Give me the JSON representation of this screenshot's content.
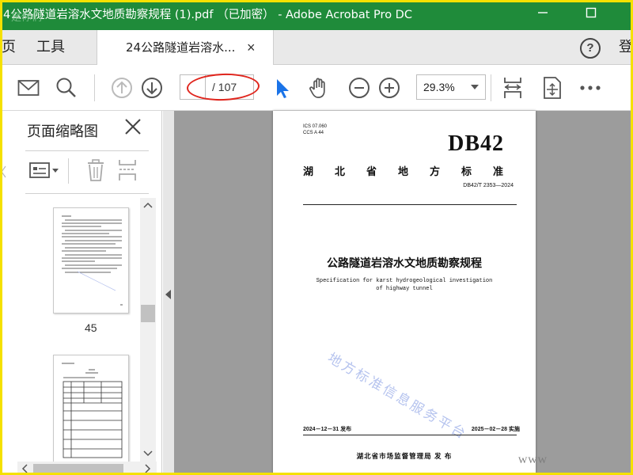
{
  "window": {
    "title": "4公路隧道岩溶水文地质勘察规程 (1).pdf （已加密） - Adobe Acrobat Pro DC",
    "ghost_text": "是你们"
  },
  "menu": {
    "home_label": "页",
    "tools_label": "工具",
    "doc_tab_label": "24公路隧道岩溶水...",
    "doc_tab_close": "×",
    "help_label": "?",
    "login_label": "登"
  },
  "toolbar": {
    "current_page": "",
    "total_pages": "/ 107",
    "zoom": "29.3%"
  },
  "thumbnails_panel": {
    "title": "页面缩略图",
    "thumbs": [
      {
        "page_number": "45"
      }
    ]
  },
  "document": {
    "ics_line": "ICS 07.060",
    "ccs_line": "CCS A 44",
    "logo": "DB42",
    "province_heading": "湖北省地方标准",
    "standard_number": "DB42/T 2353—2024",
    "title_cn": "公路隧道岩溶水文地质勘察规程",
    "title_en": "Specification for karst hydrogeological investigation of highway tunnel",
    "watermark": "地方标准信息服务平台",
    "publish_date": "2024－12－31 发布",
    "implement_date": "2025－02－28 实施",
    "issuer": "湖北省市场监督管理局    发 布"
  },
  "overlay": {
    "www": "WWW"
  },
  "colors": {
    "titlebar": "#1f8b3a",
    "frame": "#f5e100",
    "annotation_oval": "#e0261e",
    "selection_accent": "#1a73e8"
  }
}
